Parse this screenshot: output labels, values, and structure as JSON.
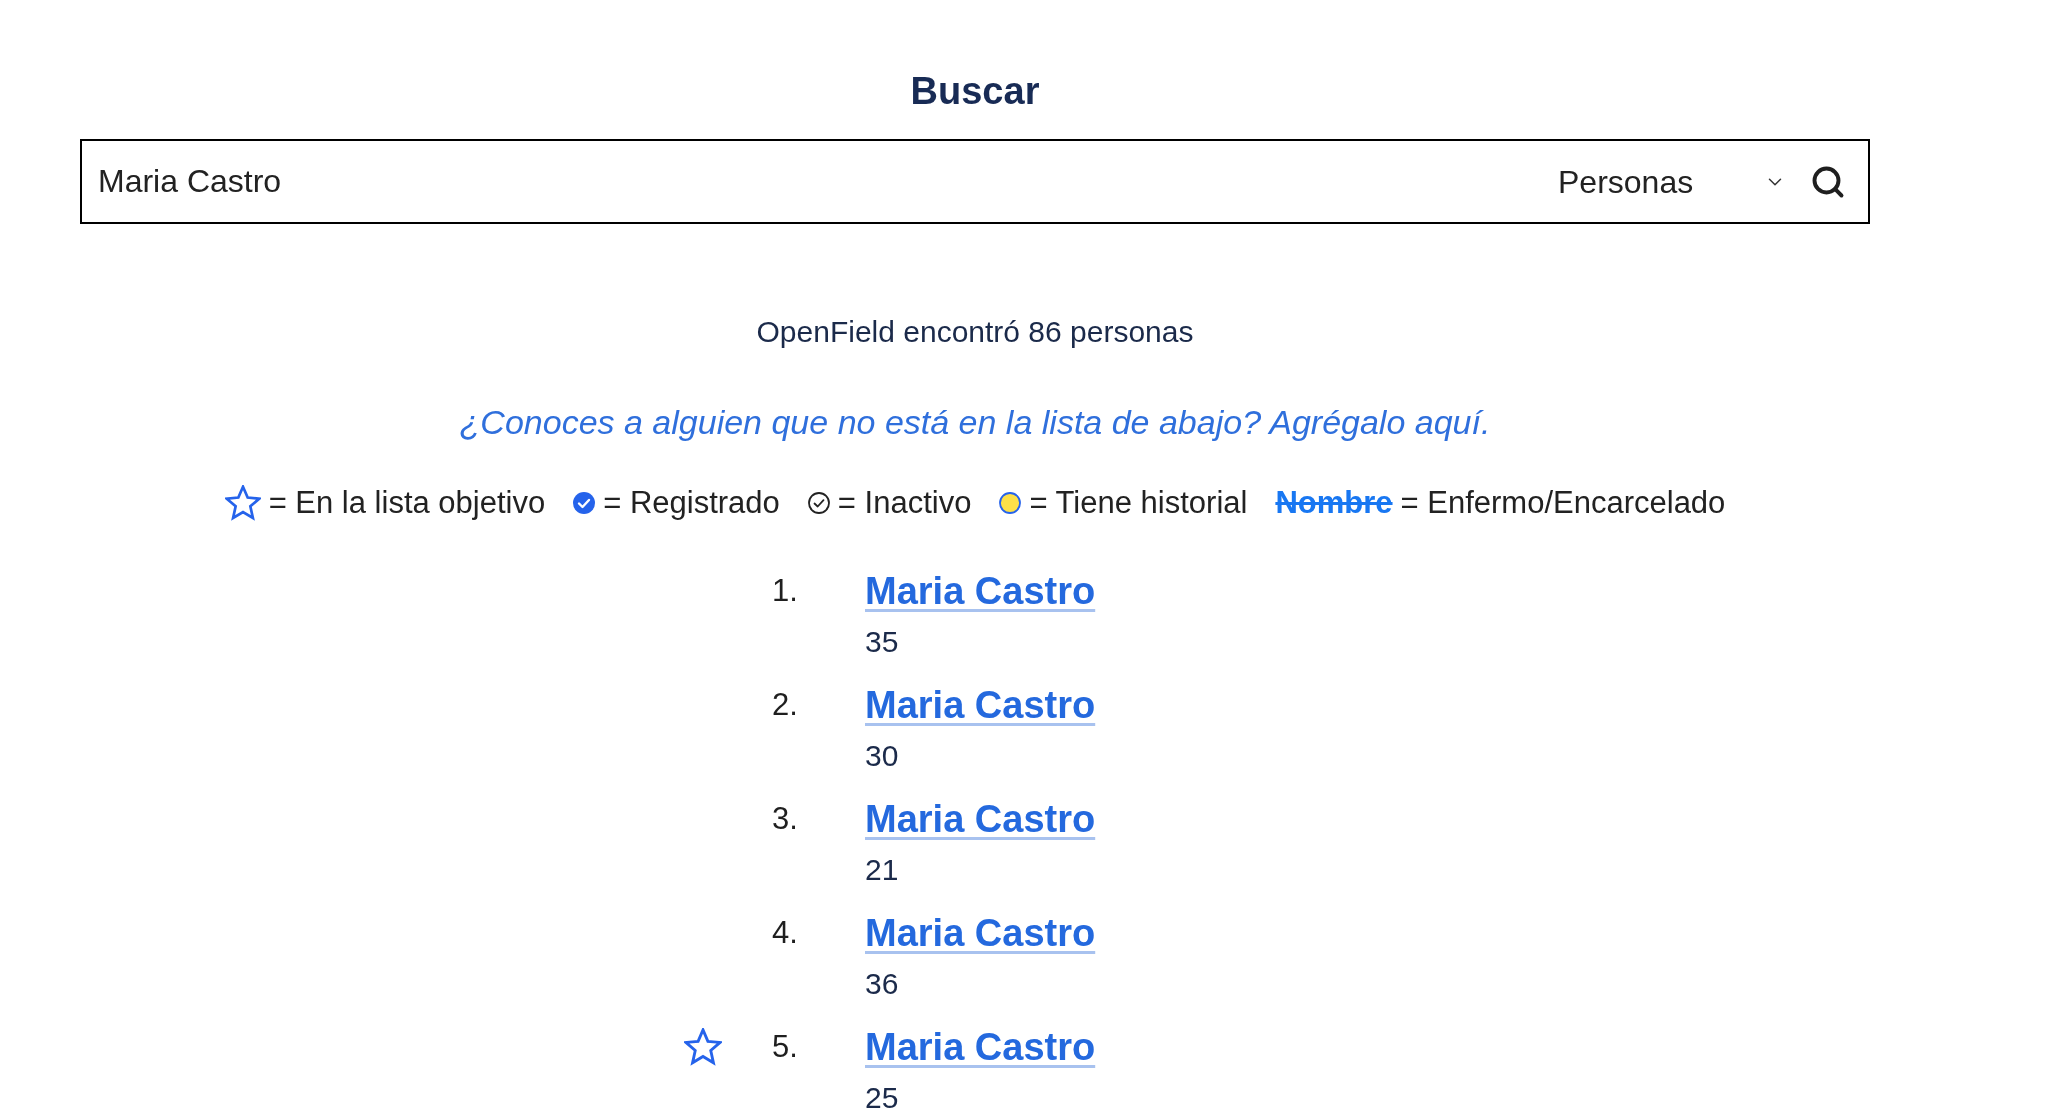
{
  "title": "Buscar",
  "search": {
    "value": "Maria Castro",
    "category": "Personas"
  },
  "result_count": "OpenField encontró 86 personas",
  "add_link": "¿Conoces a alguien que no está en la lista de abajo? Agrégalo aquí.",
  "legend": [
    {
      "kind": "target",
      "label": "= En la lista objetivo"
    },
    {
      "kind": "registered",
      "label": "= Registrado"
    },
    {
      "kind": "inactive",
      "label": "= Inactivo"
    },
    {
      "kind": "history",
      "label": "= Tiene historial"
    },
    {
      "kind": "sick",
      "sample": "Nombre",
      "label": "= Enfermo/Encarcelado"
    }
  ],
  "results": [
    {
      "number": "1.",
      "name": "Maria Castro",
      "age": "35",
      "on_target_list": false
    },
    {
      "number": "2.",
      "name": "Maria Castro",
      "age": "30",
      "on_target_list": false
    },
    {
      "number": "3.",
      "name": "Maria Castro",
      "age": "21",
      "on_target_list": false
    },
    {
      "number": "4.",
      "name": "Maria Castro",
      "age": "36",
      "on_target_list": false
    },
    {
      "number": "5.",
      "name": "Maria Castro",
      "age": "25",
      "on_target_list": true
    }
  ]
}
